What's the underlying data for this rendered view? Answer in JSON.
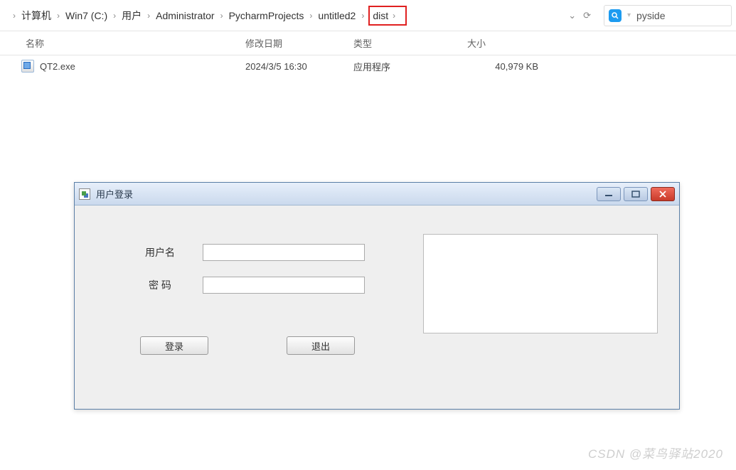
{
  "breadcrumb": {
    "items": [
      "计算机",
      "Win7 (C:)",
      "用户",
      "Administrator",
      "PycharmProjects",
      "untitled2",
      "dist"
    ],
    "highlight_index": 6
  },
  "search": {
    "text": "pyside"
  },
  "columns": {
    "name": "名称",
    "date": "修改日期",
    "type": "类型",
    "size": "大小"
  },
  "files": [
    {
      "name": "QT2.exe",
      "date": "2024/3/5 16:30",
      "type": "应用程序",
      "size": "40,979 KB"
    }
  ],
  "dialog": {
    "title": "用户登录",
    "labels": {
      "username": "用户名",
      "password": "密  码"
    },
    "buttons": {
      "login": "登录",
      "exit": "退出"
    },
    "values": {
      "username": "",
      "password": ""
    }
  },
  "watermark": "CSDN @菜鸟驿站2020"
}
